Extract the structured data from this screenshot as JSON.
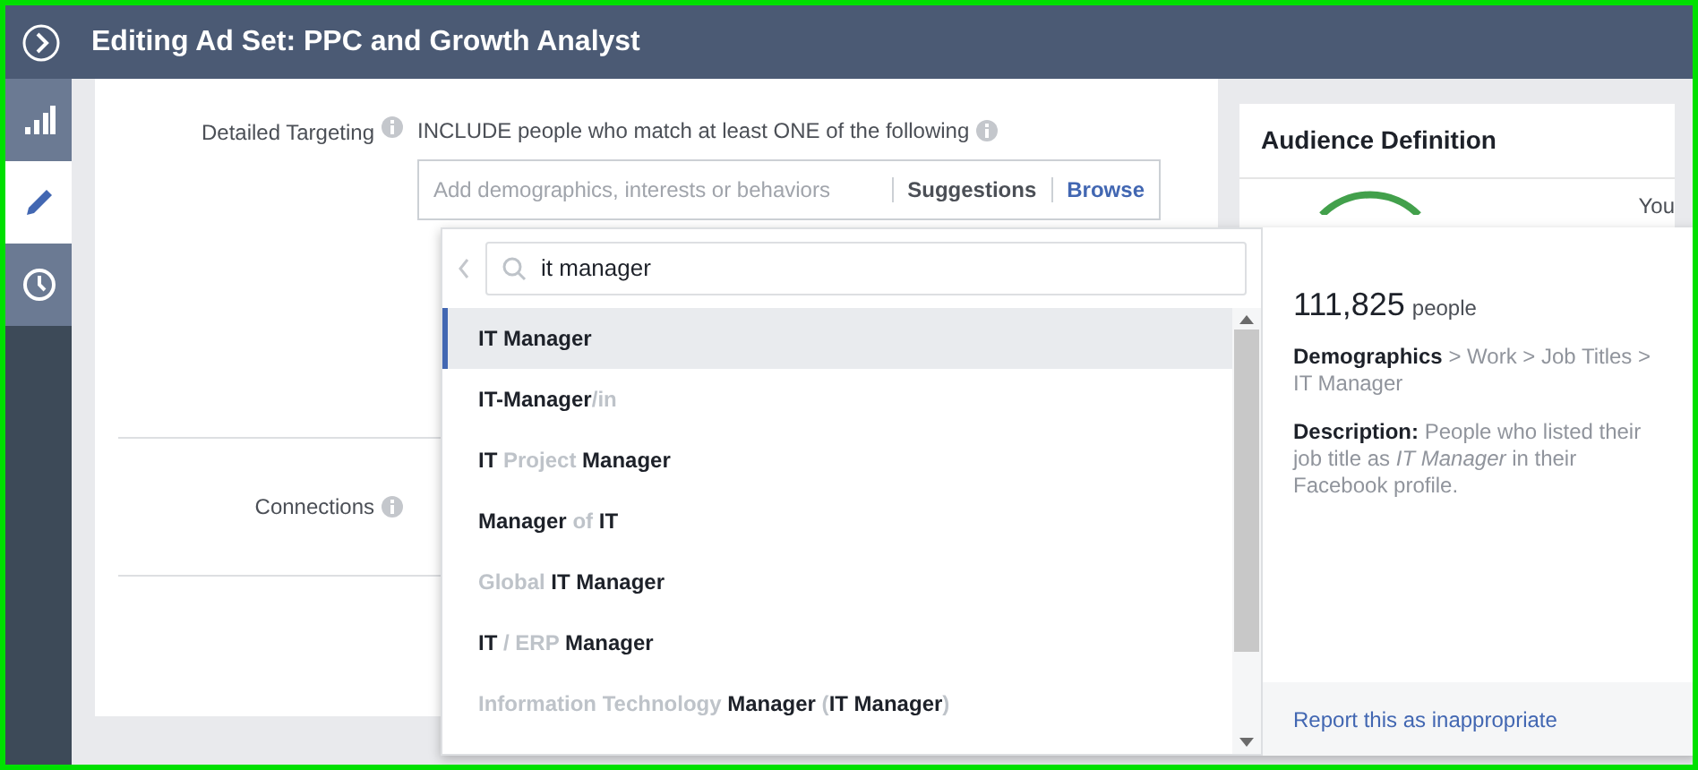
{
  "header": {
    "title": "Editing Ad Set: PPC and Growth Analyst"
  },
  "sidebar": {
    "items": [
      {
        "selected": false
      },
      {
        "selected": true
      },
      {
        "selected": false
      }
    ]
  },
  "form": {
    "detailed_targeting": {
      "label": "Detailed Targeting",
      "include_text": "INCLUDE people who match at least ONE of the following",
      "placeholder": "Add demographics, interests or behaviors",
      "suggestions": "Suggestions",
      "browse": "Browse"
    },
    "connections": {
      "label": "Connections"
    }
  },
  "audience": {
    "title": "Audience Definition",
    "cut_text": "You"
  },
  "dropdown": {
    "search_value": "it manager",
    "results": [
      {
        "selected": true,
        "parts": [
          {
            "text": "IT Manager",
            "match": true
          }
        ]
      },
      {
        "selected": false,
        "parts": [
          {
            "text": "IT-Manager",
            "match": true
          },
          {
            "text": "/in",
            "match": false
          }
        ]
      },
      {
        "selected": false,
        "parts": [
          {
            "text": "IT",
            "match": true
          },
          {
            "text": " Project ",
            "match": false
          },
          {
            "text": "Manager",
            "match": true
          }
        ]
      },
      {
        "selected": false,
        "parts": [
          {
            "text": "Manager",
            "match": true
          },
          {
            "text": " of ",
            "match": false
          },
          {
            "text": "IT",
            "match": true
          }
        ]
      },
      {
        "selected": false,
        "parts": [
          {
            "text": "Global ",
            "match": false
          },
          {
            "text": "IT Manager",
            "match": true
          }
        ]
      },
      {
        "selected": false,
        "parts": [
          {
            "text": "IT",
            "match": true
          },
          {
            "text": " / ERP ",
            "match": false
          },
          {
            "text": "Manager",
            "match": true
          }
        ]
      },
      {
        "selected": false,
        "parts": [
          {
            "text": "Information Technology ",
            "match": false
          },
          {
            "text": "Manager",
            "match": true
          },
          {
            "text": " (",
            "match": false
          },
          {
            "text": "IT Manager",
            "match": true
          },
          {
            "text": ")",
            "match": false
          }
        ]
      }
    ]
  },
  "details": {
    "count": "111,825",
    "unit": "people",
    "path": "**Demographics** > Work > Job Titles > IT Manager",
    "description": "**Description:** People who listed their job title as *IT Manager* in their Facebook profile.",
    "report_link": "Report this as inappropriate"
  }
}
